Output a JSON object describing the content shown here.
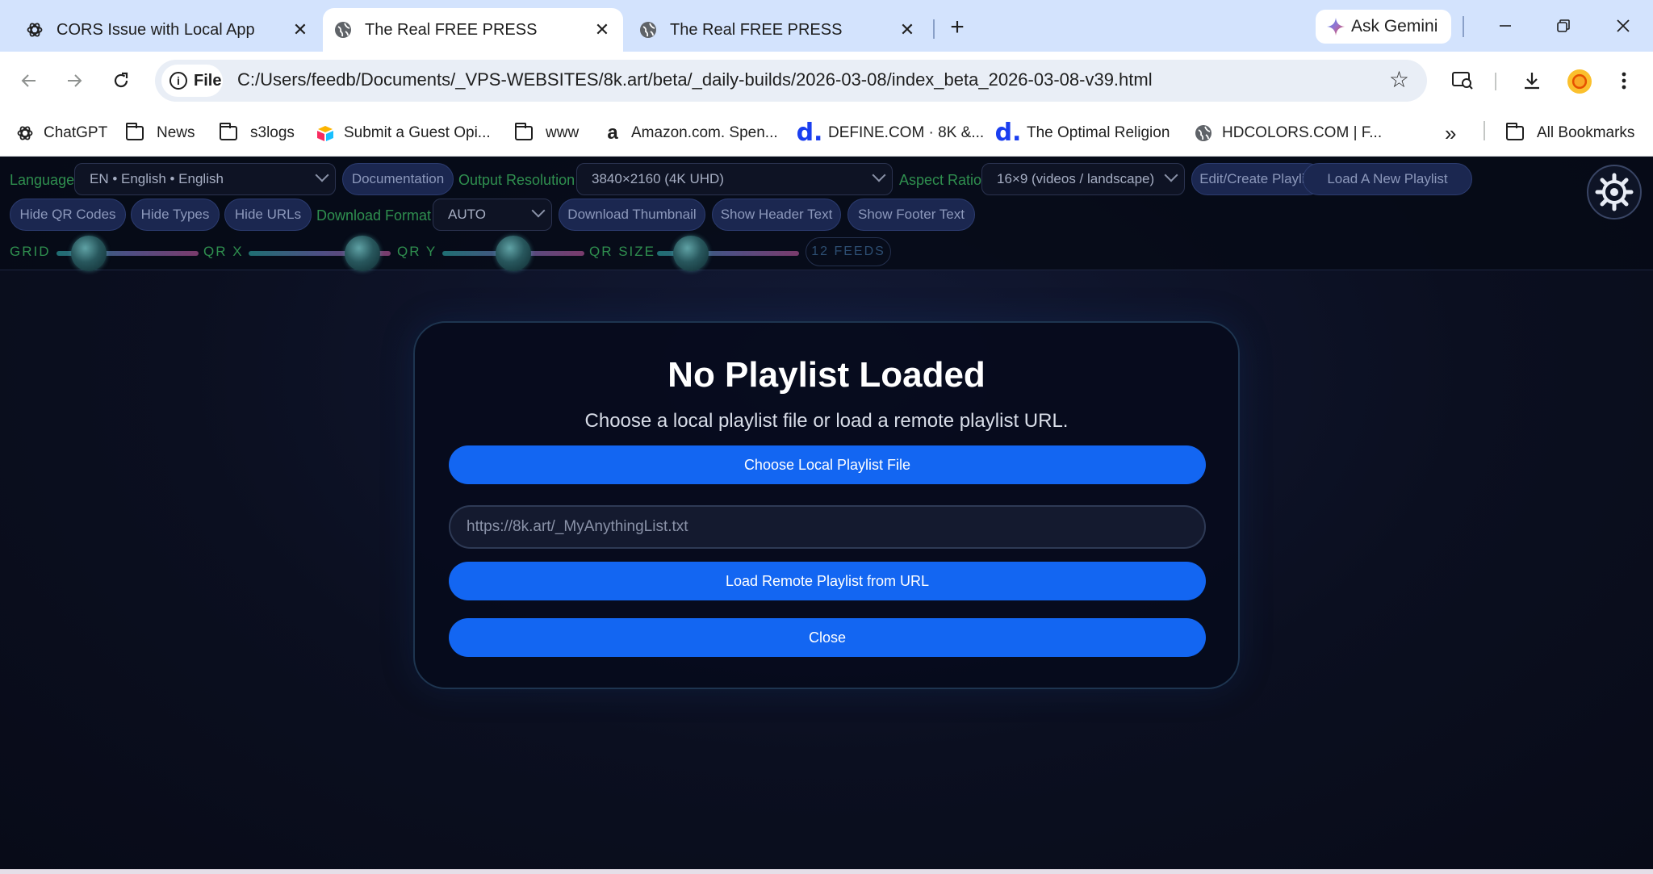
{
  "browser": {
    "tabs": [
      {
        "title": "CORS Issue with Local App",
        "icon": "openai-icon",
        "active": false
      },
      {
        "title": "The Real FREE PRESS",
        "icon": "globe-icon",
        "active": true
      },
      {
        "title": "The Real FREE PRESS",
        "icon": "globe-icon",
        "active": false
      }
    ],
    "new_tab": "+",
    "ask_gemini": "Ask Gemini",
    "address": {
      "chip": "File",
      "url": "C:/Users/feedb/Documents/_VPS-WEBSITES/8k.art/beta/_daily-builds/2026-03-08/index_beta_2026-03-08-v39.html"
    },
    "bookmarks": [
      {
        "label": "ChatGPT",
        "icon": "openai-icon"
      },
      {
        "label": "News",
        "icon": "folder-icon"
      },
      {
        "label": "s3logs",
        "icon": "folder-icon"
      },
      {
        "label": "Submit a Guest Opi...",
        "icon": "airtable-icon"
      },
      {
        "label": "www",
        "icon": "folder-icon"
      },
      {
        "label": "Amazon.com. Spen...",
        "icon": "amazon-icon"
      },
      {
        "label": "DEFINE.COM · 8K &...",
        "icon": "define-d-icon"
      },
      {
        "label": "The Optimal Religion",
        "icon": "define-d-icon"
      },
      {
        "label": "HDCOLORS.COM | F...",
        "icon": "globe-icon"
      }
    ],
    "more_bookmarks": "»",
    "all_bookmarks": "All Bookmarks"
  },
  "controls": {
    "language_label": "Language",
    "language_value": "EN • English • English",
    "documentation": "Documentation",
    "output_resolution_label": "Output Resolution",
    "output_resolution_value": "3840×2160 (4K UHD)",
    "aspect_ratio_label": "Aspect Ratio",
    "aspect_ratio_value": "16×9 (videos / landscape)",
    "edit_playlist": "Edit/Create Playlist",
    "load_playlist": "Load A New Playlist",
    "hide_qr": "Hide QR Codes",
    "hide_types": "Hide Types",
    "hide_urls": "Hide URLs",
    "download_format_label": "Download Format",
    "download_format_value": "AUTO",
    "download_thumbnail": "Download Thumbnail",
    "show_header": "Show Header Text",
    "show_footer": "Show Footer Text",
    "sliders": {
      "grid": {
        "label": "GRID",
        "value": 0.23
      },
      "qr_x": {
        "label": "QR X",
        "value": 0.8
      },
      "qr_y": {
        "label": "QR Y",
        "value": 0.5
      },
      "qr_size": {
        "label": "QR SIZE",
        "value": 0.24
      }
    },
    "feeds": "12 FEEDS"
  },
  "modal": {
    "title": "No Playlist Loaded",
    "subtitle": "Choose a local playlist file or load a remote playlist URL.",
    "choose_local": "Choose Local Playlist File",
    "url_placeholder": "https://8k.art/_MyAnythingList.txt",
    "load_remote": "Load Remote Playlist from URL",
    "close": "Close"
  },
  "colors": {
    "accent_button": "#1366f2",
    "label_green": "#2f8f4f",
    "app_background": "#0b0f1f",
    "tabstrip": "#d3e3fd"
  }
}
